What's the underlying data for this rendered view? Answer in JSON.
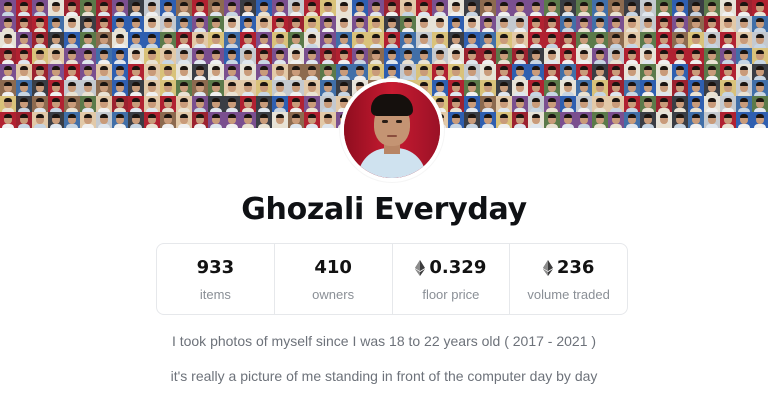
{
  "banner": {
    "palette": [
      "#e7e3d8",
      "#b12131",
      "#2f5fb0",
      "#5b7a4a",
      "#d9c27a",
      "#7a4f8f",
      "#c4c9cf",
      "#9c2230",
      "#3a3d44",
      "#e2c9a8",
      "#416fa8",
      "#8c6a4f"
    ]
  },
  "collection": {
    "name": "Ghozali Everyday",
    "stats": [
      {
        "value": "933",
        "label": "items",
        "eth": false
      },
      {
        "value": "410",
        "label": "owners",
        "eth": false
      },
      {
        "value": "0.329",
        "label": "floor price",
        "eth": true
      },
      {
        "value": "236",
        "label": "volume traded",
        "eth": true
      }
    ],
    "description": [
      "I took photos of myself since I was 18 to 22 years old ( 2017 - 2021 )",
      "it's really a picture of me standing in front of the computer day by day"
    ]
  }
}
